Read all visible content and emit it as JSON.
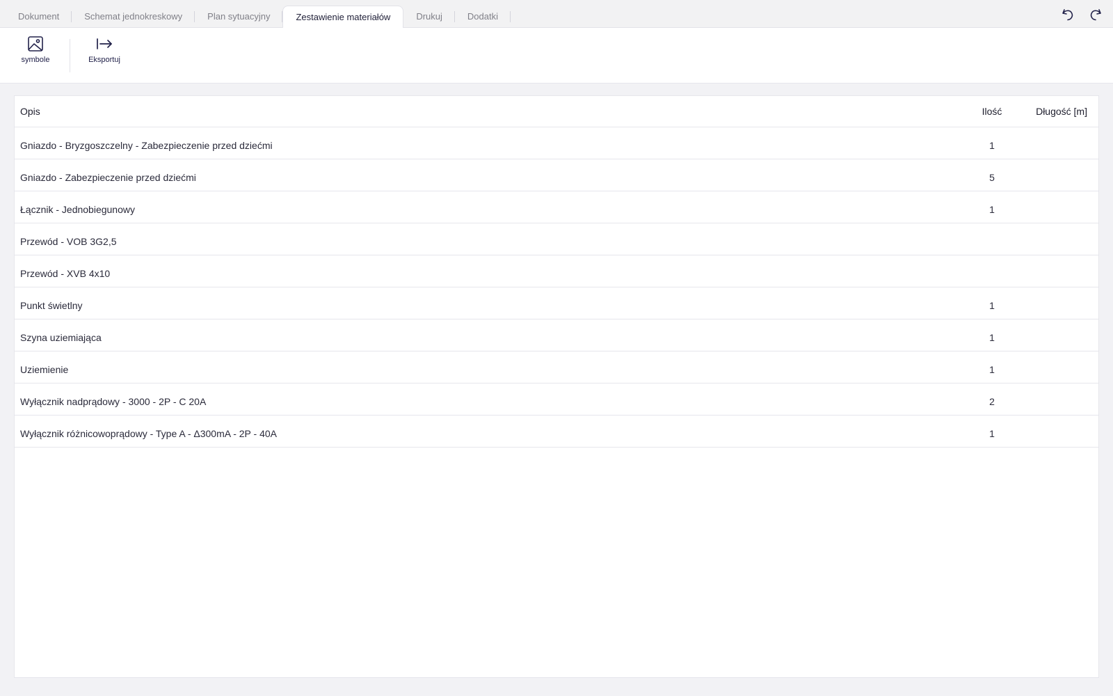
{
  "tabs": [
    {
      "label": "Dokument",
      "active": false
    },
    {
      "label": "Schemat jednokreskowy",
      "active": false
    },
    {
      "label": "Plan sytuacyjny",
      "active": false
    },
    {
      "label": "Zestawienie materiałów",
      "active": true
    },
    {
      "label": "Drukuj",
      "active": false
    },
    {
      "label": "Dodatki",
      "active": false
    }
  ],
  "history": {
    "undo_icon": "undo-icon",
    "redo_icon": "redo-icon"
  },
  "toolbar": {
    "symbols_label": "symbole",
    "symbols_icon": "image-icon",
    "export_label": "Eksportuj",
    "export_icon": "export-arrow-icon"
  },
  "table": {
    "headers": {
      "description": "Opis",
      "quantity": "Ilość",
      "length": "Długość [m]"
    },
    "rows": [
      {
        "description": "Gniazdo - Bryzgoszczelny - Zabezpieczenie przed dziećmi",
        "quantity": "1",
        "length": ""
      },
      {
        "description": "Gniazdo - Zabezpieczenie przed dziećmi",
        "quantity": "5",
        "length": ""
      },
      {
        "description": "Łącznik - Jednobiegunowy",
        "quantity": "1",
        "length": ""
      },
      {
        "description": "Przewód - VOB 3G2,5",
        "quantity": "",
        "length": ""
      },
      {
        "description": "Przewód - XVB 4x10",
        "quantity": "",
        "length": ""
      },
      {
        "description": "Punkt świetlny",
        "quantity": "1",
        "length": ""
      },
      {
        "description": "Szyna uziemiająca",
        "quantity": "1",
        "length": ""
      },
      {
        "description": "Uziemienie",
        "quantity": "1",
        "length": ""
      },
      {
        "description": "Wyłącznik nadprądowy - 3000 - 2P - C 20A",
        "quantity": "2",
        "length": ""
      },
      {
        "description": "Wyłącznik różnicowoprądowy - Type A - Δ300mA - 2P - 40A",
        "quantity": "1",
        "length": ""
      }
    ]
  },
  "colors": {
    "accent": "#22224a",
    "background": "#f2f2f5",
    "panel": "#ffffff",
    "border": "#e6e6ec"
  }
}
